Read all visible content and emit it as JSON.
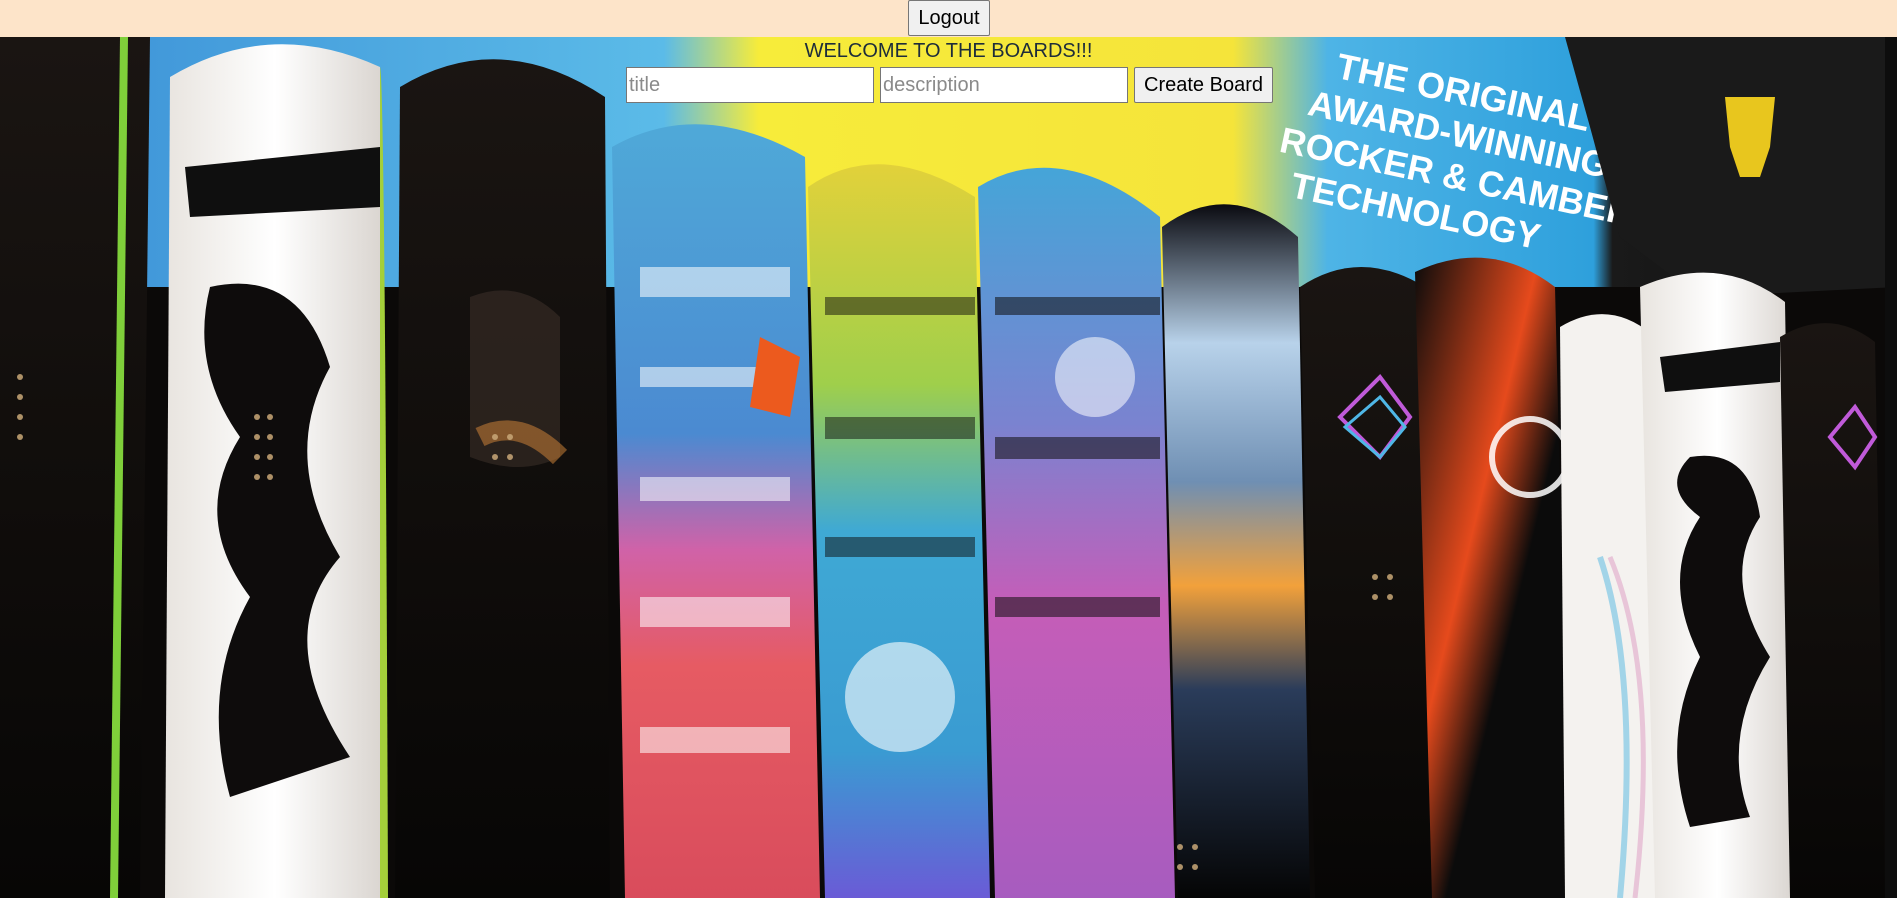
{
  "header": {
    "logout_label": "Logout",
    "background_color": "#fde4c9"
  },
  "main": {
    "welcome_text": "WELCOME TO THE BOARDS!!!",
    "title_placeholder": "title",
    "description_placeholder": "description",
    "title_value": "",
    "description_value": "",
    "create_label": "Create Board"
  },
  "background": {
    "banner_text": [
      "THE ORIGINAL",
      "AWARD-WINNING",
      "ROCKER & CAMBER",
      "TECHNOLOGY"
    ]
  }
}
